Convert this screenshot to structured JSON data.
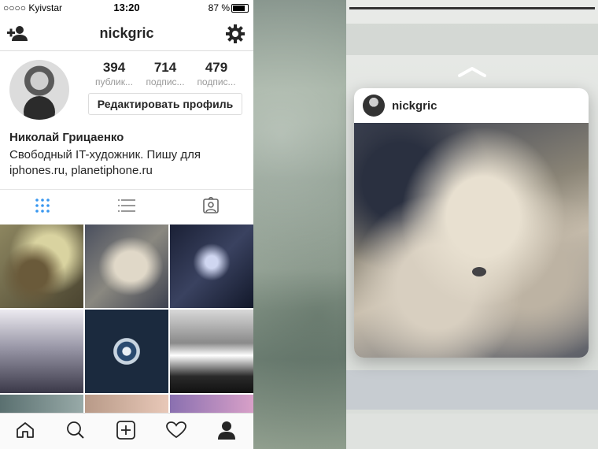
{
  "status_bar": {
    "carrier": "○○○○ Kyivstar",
    "time": "13:20",
    "battery": "87 %"
  },
  "profile": {
    "username": "nickgric",
    "stats": [
      {
        "value": "394",
        "label": "публик..."
      },
      {
        "value": "714",
        "label": "подпис..."
      },
      {
        "value": "479",
        "label": "подпис..."
      }
    ],
    "edit_button": "Редактировать профиль",
    "full_name": "Николай Грицаенко",
    "bio_line1": "Свободный IT-художник. Пишу для",
    "bio_line2": "iphones.ru, planetiphone.ru"
  },
  "tabs": [
    "grid-icon",
    "list-icon",
    "tagged-icon"
  ],
  "bottom_nav": [
    "home-icon",
    "search-icon",
    "add-post-icon",
    "heart-icon",
    "profile-icon"
  ],
  "preview": {
    "username": "nickgric"
  },
  "colors": {
    "accent": "#3897f0",
    "text": "#262626",
    "muted": "#999999"
  }
}
